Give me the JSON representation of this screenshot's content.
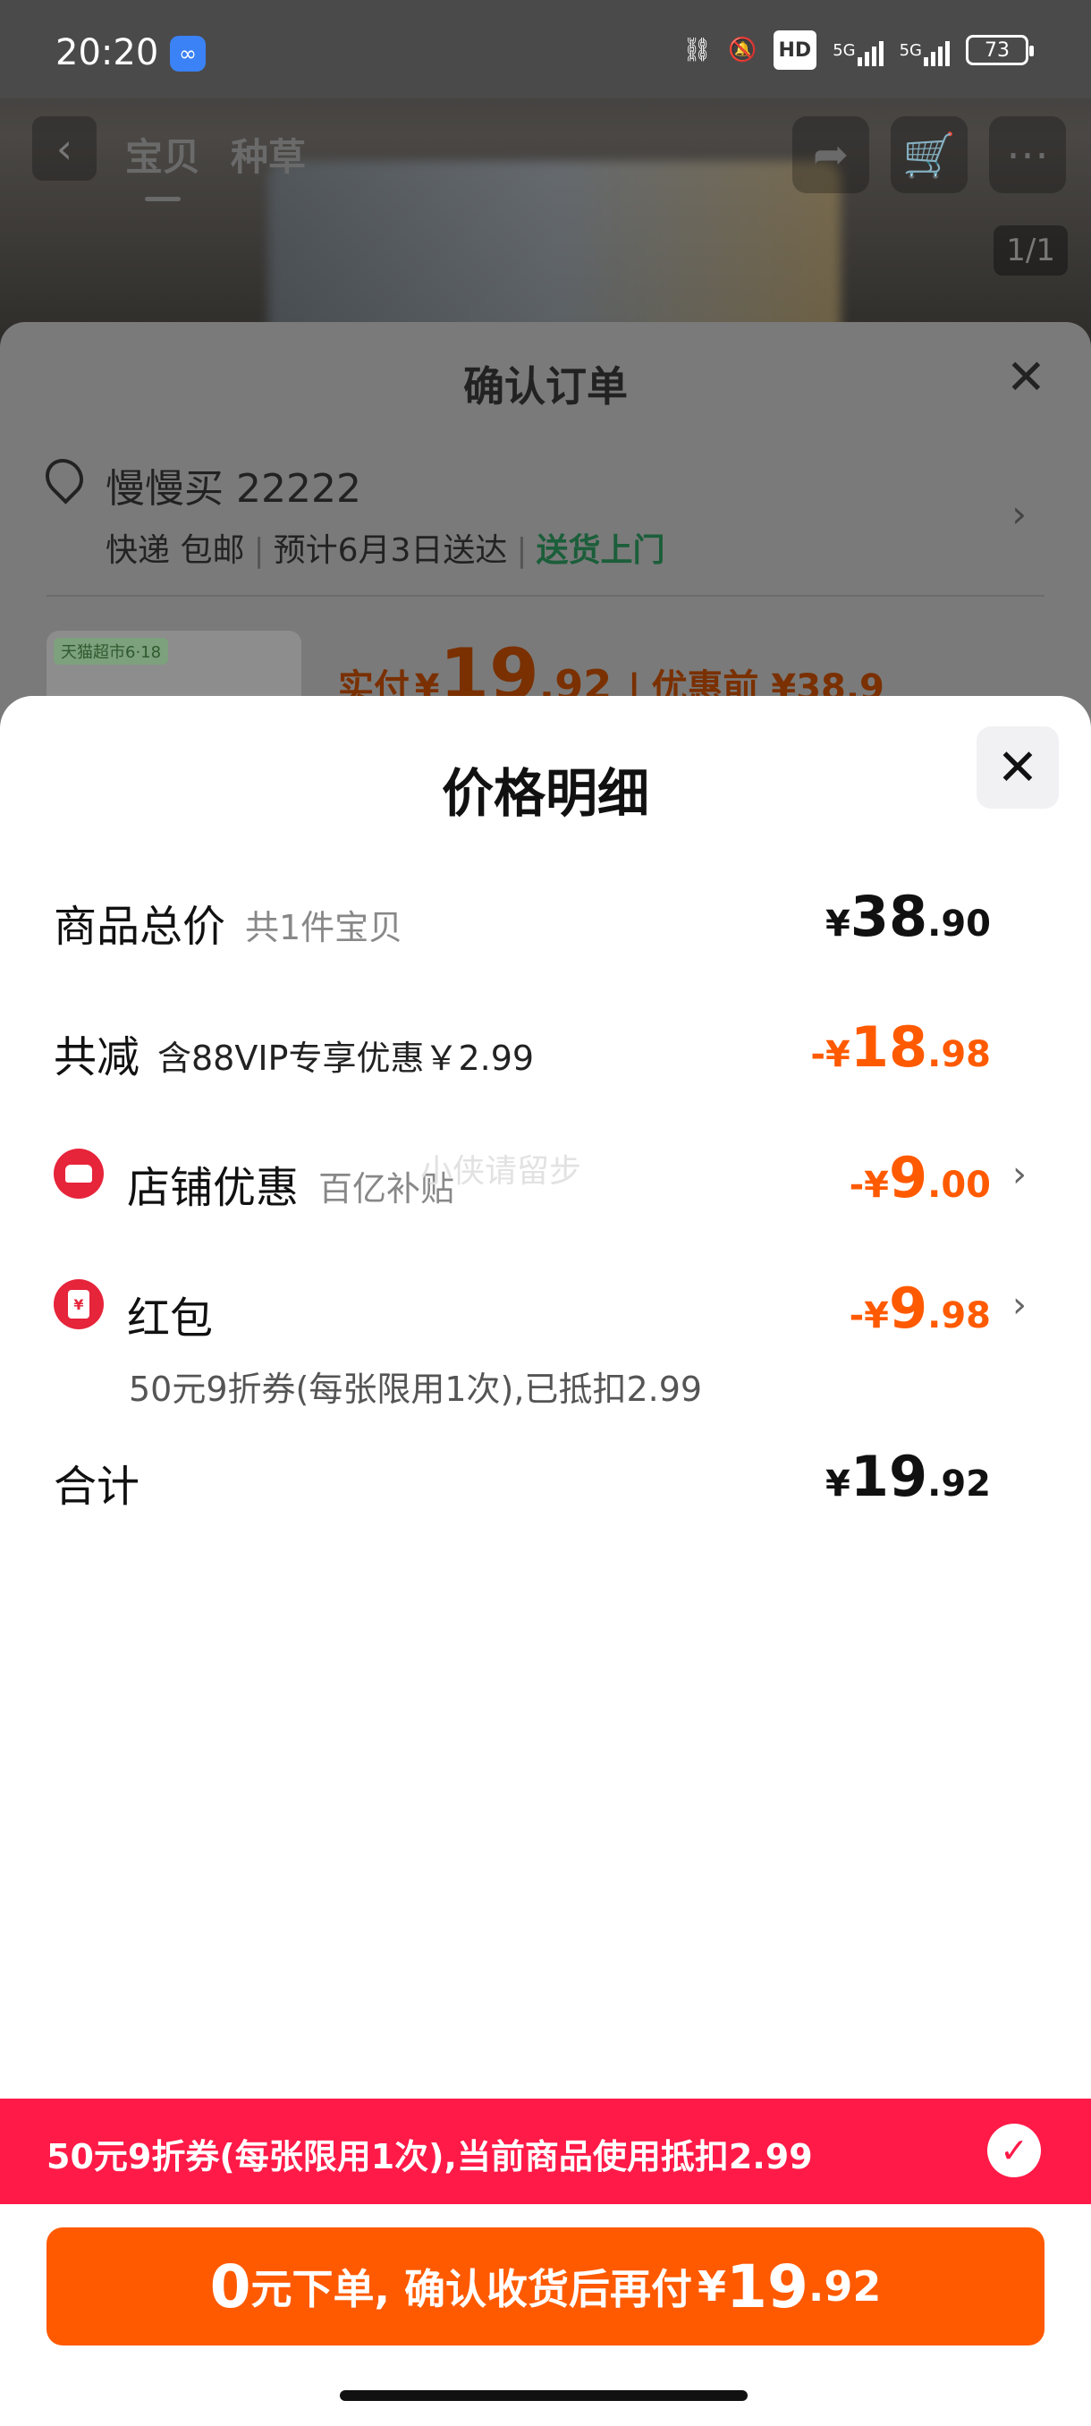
{
  "status_bar": {
    "time": "20:20",
    "battery": "73",
    "network_label": "5G",
    "hd_label": "HD"
  },
  "nav": {
    "back_icon": "chevron-left-icon",
    "tabs": [
      {
        "label": "宝贝",
        "active": true
      },
      {
        "label": "种草",
        "active": false
      }
    ],
    "image_counter": "1/1"
  },
  "confirm_order": {
    "title": "确认订单",
    "address_name": "慢慢买 22222",
    "shipping": "快递 包邮",
    "eta": "预计6月3日送达",
    "delivery": "送货上门",
    "thumb_tag": "天猫超市6·18",
    "pay_label": "实付",
    "pay_currency": "¥",
    "pay_int": "19",
    "pay_dec": ".92",
    "pre_discount": "优惠前 ¥38.9"
  },
  "price_detail": {
    "title": "价格明细",
    "rows": {
      "total": {
        "label": "商品总价",
        "sub": "共1件宝贝",
        "currency": "¥",
        "int": "38",
        "dec": ".90"
      },
      "reduce": {
        "label": "共减",
        "sub": "含88VIP专享优惠￥2.99",
        "currency": "-¥",
        "int": "18",
        "dec": ".98"
      },
      "shop": {
        "label": "店铺优惠",
        "sub": "百亿补贴",
        "currency": "-¥",
        "int": "9",
        "dec": ".00"
      },
      "redpacket": {
        "label": "红包",
        "desc": "50元9折券(每张限用1次),已抵扣2.99",
        "currency": "-¥",
        "int": "9",
        "dec": ".98",
        "icon_glyph": "¥"
      },
      "sum": {
        "label": "合计",
        "currency": "¥",
        "int": "19",
        "dec": ".92"
      }
    },
    "watermark": "小侠请留步"
  },
  "coupon_banner": {
    "text": "50元9折券(每张限用1次),当前商品使用抵扣2.99"
  },
  "order_button": {
    "zero": "0",
    "text": "元下单, 确认收货后再付",
    "currency": "¥",
    "int": "19",
    "dec": ".92"
  },
  "colors": {
    "accent_orange": "#ff5a00",
    "banner_red": "#ff1a48",
    "icon_red": "#e6243a",
    "delivery_green": "#1b5e3a"
  }
}
